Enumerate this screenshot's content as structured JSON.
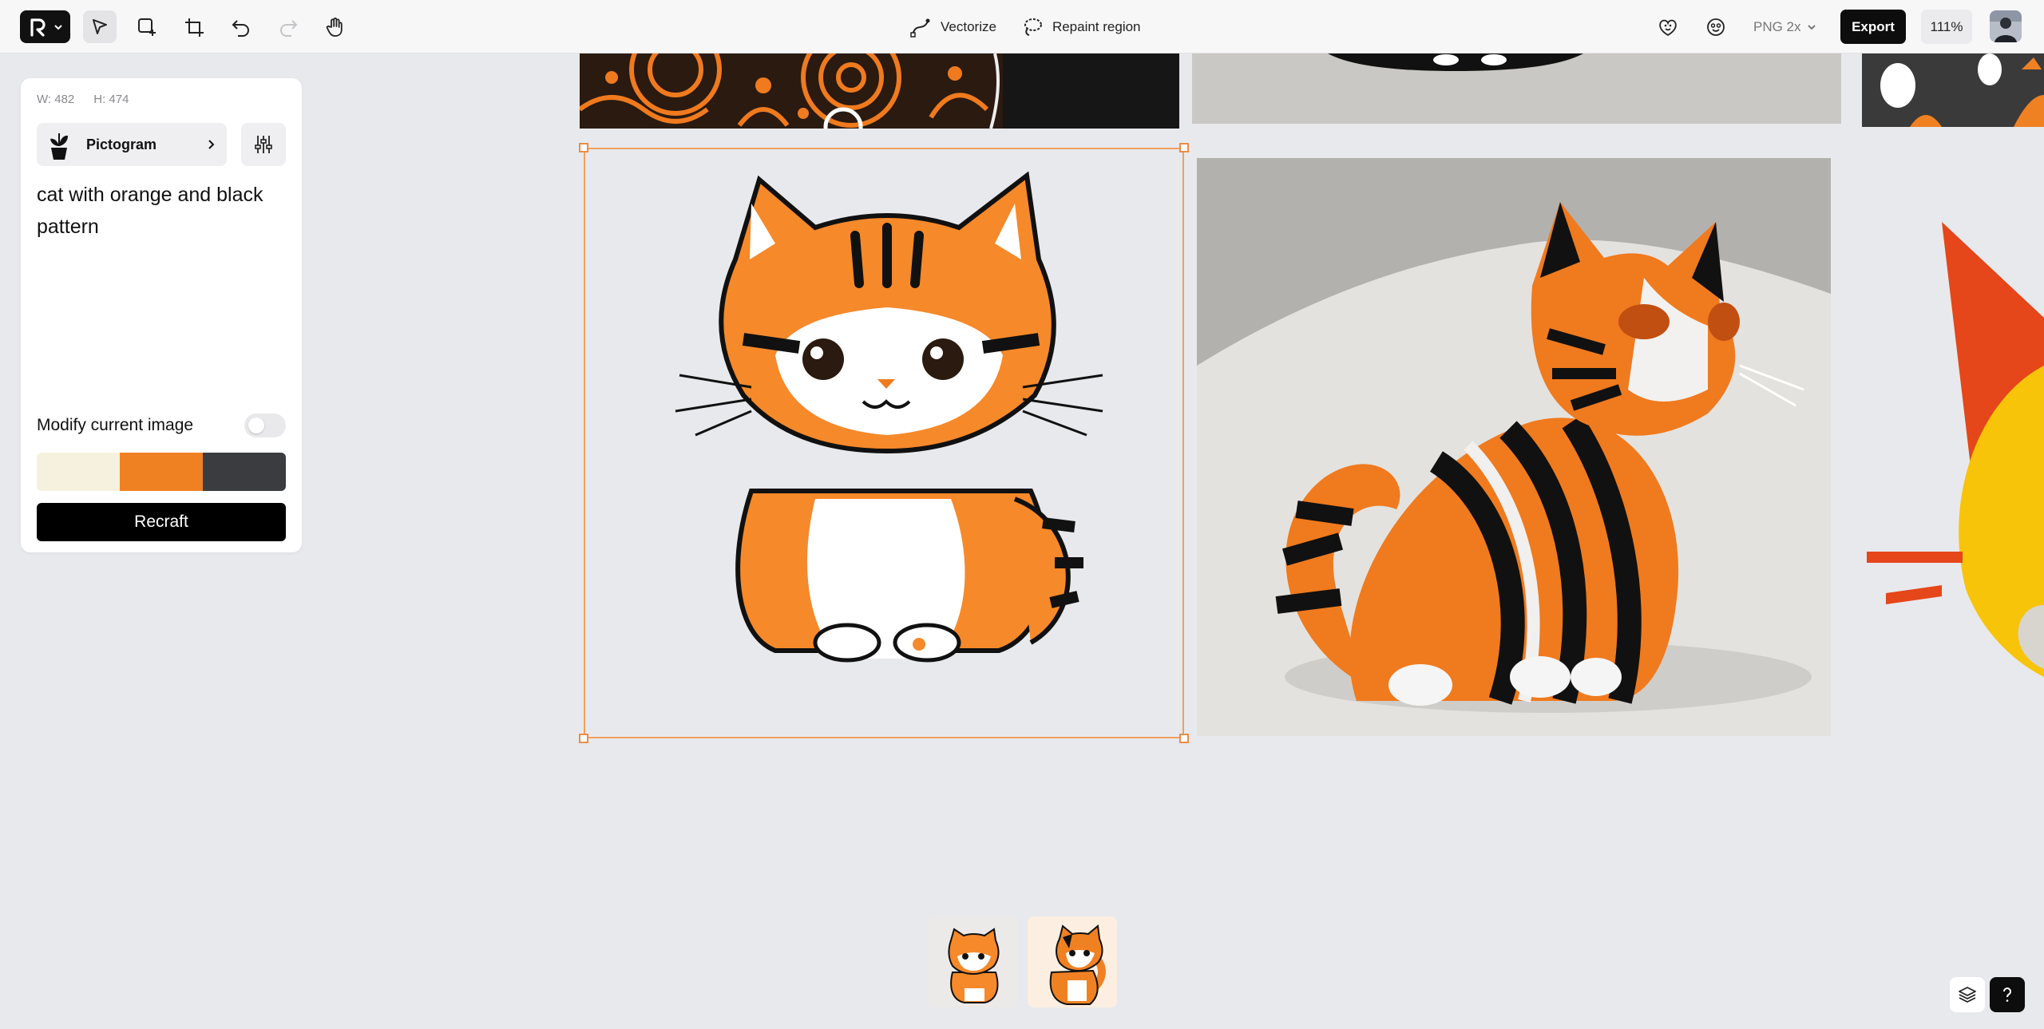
{
  "toolbar": {
    "tools": [
      "select-tool",
      "frame-tool",
      "crop-tool",
      "undo",
      "redo",
      "hand-tool"
    ],
    "vectorize_label": "Vectorize",
    "repaint_label": "Repaint region",
    "format_label": "PNG 2x",
    "export_label": "Export",
    "zoom_label": "111%"
  },
  "panel": {
    "width_label": "W: 482",
    "height_label": "H: 474",
    "style_label": "Pictogram",
    "prompt_text": "cat with orange and black pattern",
    "modify_label": "Modify current image",
    "modify_enabled": false,
    "palette": [
      "#f6f1de",
      "#f08122",
      "#3b3c3f"
    ],
    "recraft_label": "Recraft"
  },
  "colors": {
    "accent": "#f08122",
    "selection": "#e88d45",
    "canvas_bg": "#e8e9ec"
  },
  "thumbnails": [
    {
      "name": "cat-thumb-1",
      "selected": false
    },
    {
      "name": "cat-thumb-2",
      "selected": true
    }
  ]
}
